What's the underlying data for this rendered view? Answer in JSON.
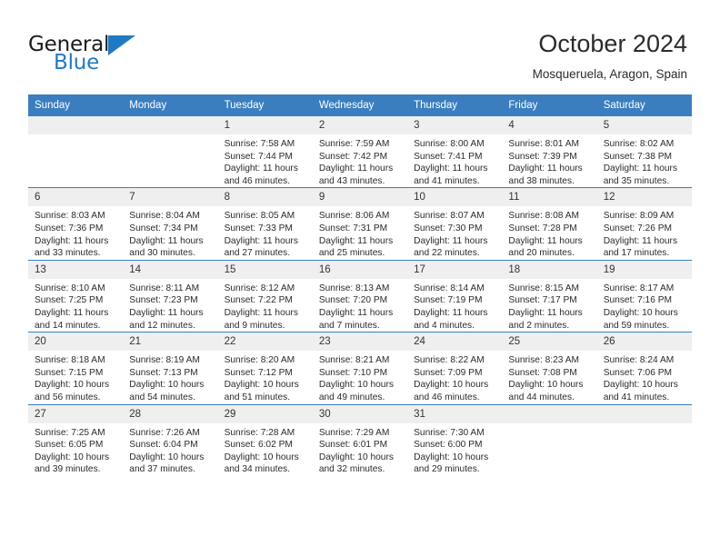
{
  "brand": {
    "name_top": "General",
    "name_bottom": "Blue",
    "accent_color": "#1f7ac4"
  },
  "header": {
    "title": "October 2024",
    "subtitle": "Mosqueruela, Aragon, Spain"
  },
  "calendar": {
    "header_color": "#3a7ebf",
    "daynum_bg": "#efefef",
    "weekday_headers": [
      "Sunday",
      "Monday",
      "Tuesday",
      "Wednesday",
      "Thursday",
      "Friday",
      "Saturday"
    ],
    "weeks": [
      [
        {
          "day": "",
          "sunrise": "",
          "sunset": "",
          "daylight": ""
        },
        {
          "day": "",
          "sunrise": "",
          "sunset": "",
          "daylight": ""
        },
        {
          "day": "1",
          "sunrise": "Sunrise: 7:58 AM",
          "sunset": "Sunset: 7:44 PM",
          "daylight": "Daylight: 11 hours and 46 minutes."
        },
        {
          "day": "2",
          "sunrise": "Sunrise: 7:59 AM",
          "sunset": "Sunset: 7:42 PM",
          "daylight": "Daylight: 11 hours and 43 minutes."
        },
        {
          "day": "3",
          "sunrise": "Sunrise: 8:00 AM",
          "sunset": "Sunset: 7:41 PM",
          "daylight": "Daylight: 11 hours and 41 minutes."
        },
        {
          "day": "4",
          "sunrise": "Sunrise: 8:01 AM",
          "sunset": "Sunset: 7:39 PM",
          "daylight": "Daylight: 11 hours and 38 minutes."
        },
        {
          "day": "5",
          "sunrise": "Sunrise: 8:02 AM",
          "sunset": "Sunset: 7:38 PM",
          "daylight": "Daylight: 11 hours and 35 minutes."
        }
      ],
      [
        {
          "day": "6",
          "sunrise": "Sunrise: 8:03 AM",
          "sunset": "Sunset: 7:36 PM",
          "daylight": "Daylight: 11 hours and 33 minutes."
        },
        {
          "day": "7",
          "sunrise": "Sunrise: 8:04 AM",
          "sunset": "Sunset: 7:34 PM",
          "daylight": "Daylight: 11 hours and 30 minutes."
        },
        {
          "day": "8",
          "sunrise": "Sunrise: 8:05 AM",
          "sunset": "Sunset: 7:33 PM",
          "daylight": "Daylight: 11 hours and 27 minutes."
        },
        {
          "day": "9",
          "sunrise": "Sunrise: 8:06 AM",
          "sunset": "Sunset: 7:31 PM",
          "daylight": "Daylight: 11 hours and 25 minutes."
        },
        {
          "day": "10",
          "sunrise": "Sunrise: 8:07 AM",
          "sunset": "Sunset: 7:30 PM",
          "daylight": "Daylight: 11 hours and 22 minutes."
        },
        {
          "day": "11",
          "sunrise": "Sunrise: 8:08 AM",
          "sunset": "Sunset: 7:28 PM",
          "daylight": "Daylight: 11 hours and 20 minutes."
        },
        {
          "day": "12",
          "sunrise": "Sunrise: 8:09 AM",
          "sunset": "Sunset: 7:26 PM",
          "daylight": "Daylight: 11 hours and 17 minutes."
        }
      ],
      [
        {
          "day": "13",
          "sunrise": "Sunrise: 8:10 AM",
          "sunset": "Sunset: 7:25 PM",
          "daylight": "Daylight: 11 hours and 14 minutes."
        },
        {
          "day": "14",
          "sunrise": "Sunrise: 8:11 AM",
          "sunset": "Sunset: 7:23 PM",
          "daylight": "Daylight: 11 hours and 12 minutes."
        },
        {
          "day": "15",
          "sunrise": "Sunrise: 8:12 AM",
          "sunset": "Sunset: 7:22 PM",
          "daylight": "Daylight: 11 hours and 9 minutes."
        },
        {
          "day": "16",
          "sunrise": "Sunrise: 8:13 AM",
          "sunset": "Sunset: 7:20 PM",
          "daylight": "Daylight: 11 hours and 7 minutes."
        },
        {
          "day": "17",
          "sunrise": "Sunrise: 8:14 AM",
          "sunset": "Sunset: 7:19 PM",
          "daylight": "Daylight: 11 hours and 4 minutes."
        },
        {
          "day": "18",
          "sunrise": "Sunrise: 8:15 AM",
          "sunset": "Sunset: 7:17 PM",
          "daylight": "Daylight: 11 hours and 2 minutes."
        },
        {
          "day": "19",
          "sunrise": "Sunrise: 8:17 AM",
          "sunset": "Sunset: 7:16 PM",
          "daylight": "Daylight: 10 hours and 59 minutes."
        }
      ],
      [
        {
          "day": "20",
          "sunrise": "Sunrise: 8:18 AM",
          "sunset": "Sunset: 7:15 PM",
          "daylight": "Daylight: 10 hours and 56 minutes."
        },
        {
          "day": "21",
          "sunrise": "Sunrise: 8:19 AM",
          "sunset": "Sunset: 7:13 PM",
          "daylight": "Daylight: 10 hours and 54 minutes."
        },
        {
          "day": "22",
          "sunrise": "Sunrise: 8:20 AM",
          "sunset": "Sunset: 7:12 PM",
          "daylight": "Daylight: 10 hours and 51 minutes."
        },
        {
          "day": "23",
          "sunrise": "Sunrise: 8:21 AM",
          "sunset": "Sunset: 7:10 PM",
          "daylight": "Daylight: 10 hours and 49 minutes."
        },
        {
          "day": "24",
          "sunrise": "Sunrise: 8:22 AM",
          "sunset": "Sunset: 7:09 PM",
          "daylight": "Daylight: 10 hours and 46 minutes."
        },
        {
          "day": "25",
          "sunrise": "Sunrise: 8:23 AM",
          "sunset": "Sunset: 7:08 PM",
          "daylight": "Daylight: 10 hours and 44 minutes."
        },
        {
          "day": "26",
          "sunrise": "Sunrise: 8:24 AM",
          "sunset": "Sunset: 7:06 PM",
          "daylight": "Daylight: 10 hours and 41 minutes."
        }
      ],
      [
        {
          "day": "27",
          "sunrise": "Sunrise: 7:25 AM",
          "sunset": "Sunset: 6:05 PM",
          "daylight": "Daylight: 10 hours and 39 minutes."
        },
        {
          "day": "28",
          "sunrise": "Sunrise: 7:26 AM",
          "sunset": "Sunset: 6:04 PM",
          "daylight": "Daylight: 10 hours and 37 minutes."
        },
        {
          "day": "29",
          "sunrise": "Sunrise: 7:28 AM",
          "sunset": "Sunset: 6:02 PM",
          "daylight": "Daylight: 10 hours and 34 minutes."
        },
        {
          "day": "30",
          "sunrise": "Sunrise: 7:29 AM",
          "sunset": "Sunset: 6:01 PM",
          "daylight": "Daylight: 10 hours and 32 minutes."
        },
        {
          "day": "31",
          "sunrise": "Sunrise: 7:30 AM",
          "sunset": "Sunset: 6:00 PM",
          "daylight": "Daylight: 10 hours and 29 minutes."
        },
        {
          "day": "",
          "sunrise": "",
          "sunset": "",
          "daylight": ""
        },
        {
          "day": "",
          "sunrise": "",
          "sunset": "",
          "daylight": ""
        }
      ]
    ]
  }
}
